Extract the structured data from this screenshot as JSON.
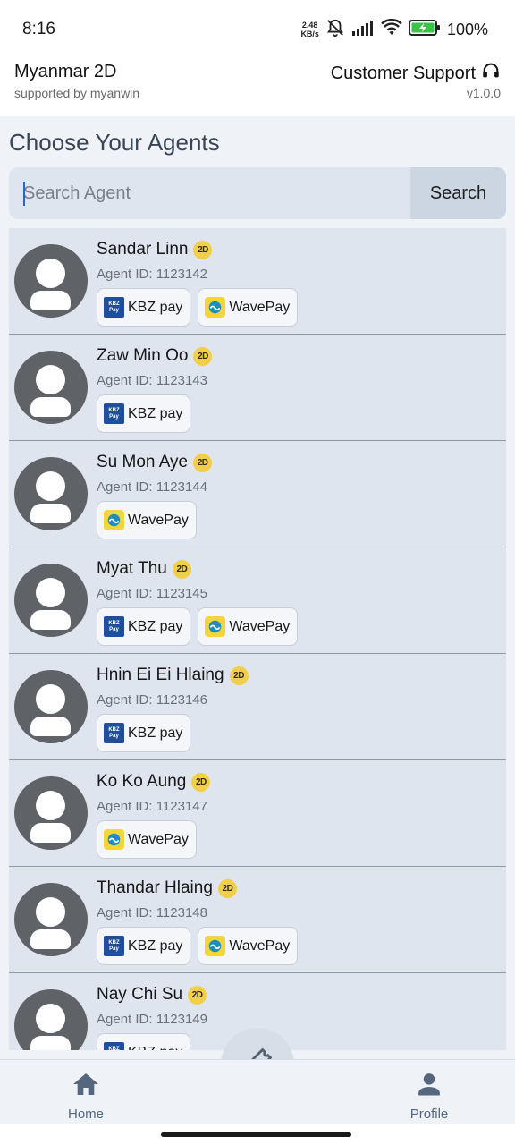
{
  "status_bar": {
    "time": "8:16",
    "net_speed_value": "2.48",
    "net_speed_unit": "KB/s",
    "battery": "100%"
  },
  "header": {
    "title": "Myanmar 2D",
    "subtitle": "supported by myanwin",
    "support_label": "Customer Support",
    "version": "v1.0.0"
  },
  "main": {
    "section_title": "Choose Your Agents",
    "search": {
      "placeholder": "Search Agent",
      "value": "",
      "button_label": "Search"
    }
  },
  "badge_label": "2D",
  "payment_labels": {
    "kbz": "KBZ pay",
    "wave": "WavePay"
  },
  "agents": [
    {
      "name": "Sandar Linn",
      "agent_id": "Agent ID: 1123142",
      "payments": [
        "kbz",
        "wave"
      ]
    },
    {
      "name": "Zaw Min Oo",
      "agent_id": "Agent ID: 1123143",
      "payments": [
        "kbz"
      ]
    },
    {
      "name": "Su Mon Aye",
      "agent_id": "Agent ID: 1123144",
      "payments": [
        "wave"
      ]
    },
    {
      "name": "Myat Thu",
      "agent_id": "Agent ID: 1123145",
      "payments": [
        "kbz",
        "wave"
      ]
    },
    {
      "name": "Hnin Ei Ei Hlaing",
      "agent_id": "Agent ID: 1123146",
      "payments": [
        "kbz"
      ]
    },
    {
      "name": "Ko Ko Aung",
      "agent_id": "Agent ID: 1123147",
      "payments": [
        "wave"
      ]
    },
    {
      "name": "Thandar Hlaing",
      "agent_id": "Agent ID: 1123148",
      "payments": [
        "kbz",
        "wave"
      ]
    },
    {
      "name": "Nay Chi Su",
      "agent_id": "Agent ID: 1123149",
      "payments": [
        "kbz"
      ]
    }
  ],
  "bottom_nav": {
    "home_label": "Home",
    "profile_label": "Profile",
    "center_icon": "ticket-icon"
  },
  "colors": {
    "accent_nav": "#56677d",
    "card_bg": "#dfe5ee",
    "badge": "#f1cf4a",
    "kbz": "#1d4f9c",
    "wave": "#f4d53a"
  }
}
